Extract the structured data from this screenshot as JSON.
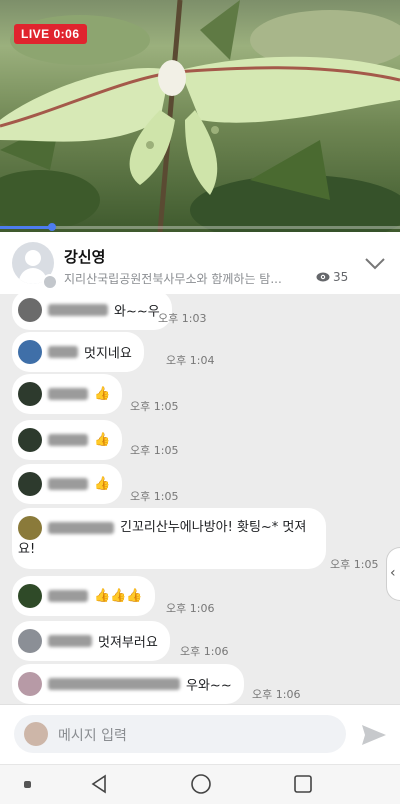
{
  "video": {
    "live_label": "LIVE 0:06",
    "progress_fraction": 0.13
  },
  "header": {
    "host_name": "강신영",
    "subtitle": "지리산국립공원전북사무소와 함께하는 탐...",
    "viewers": "35"
  },
  "chat": {
    "messages": [
      {
        "text": "와~~우",
        "time": "오후 1:03",
        "avatar_color": "#6b6b6b"
      },
      {
        "text": "멋지네요",
        "time": "오후 1:04",
        "avatar_color": "#3f6fa8"
      },
      {
        "text": "👍",
        "time": "오후 1:05",
        "avatar_color": "#2d3a2d"
      },
      {
        "text": "👍",
        "time": "오후 1:05",
        "avatar_color": "#2d3a2d"
      },
      {
        "text": "👍",
        "time": "오후 1:05",
        "avatar_color": "#2d3a2d"
      },
      {
        "text": "긴꼬리산누에나방아! 홧팅~* 멋져요!",
        "time": "오후 1:05",
        "avatar_color": "#8a7a3a"
      },
      {
        "text": "👍👍👍",
        "time": "오후 1:06",
        "avatar_color": "#2f4a28"
      },
      {
        "text": "멋져부러요",
        "time": "오후 1:06",
        "avatar_color": "#8b8f96"
      },
      {
        "text": "우와~~",
        "time": "오후 1:06",
        "avatar_color": "#b79aa6"
      }
    ],
    "side_tab_icon": "chevron-left-icon"
  },
  "input": {
    "placeholder": "메시지 입력",
    "send_icon": "send-icon"
  },
  "navbar": {
    "icons": [
      "recent-dot-icon",
      "back-icon",
      "home-icon",
      "overview-icon"
    ]
  },
  "colors": {
    "live_red": "#e0242e",
    "progress_blue": "#4d7cf0",
    "chat_bg": "#ececec"
  }
}
